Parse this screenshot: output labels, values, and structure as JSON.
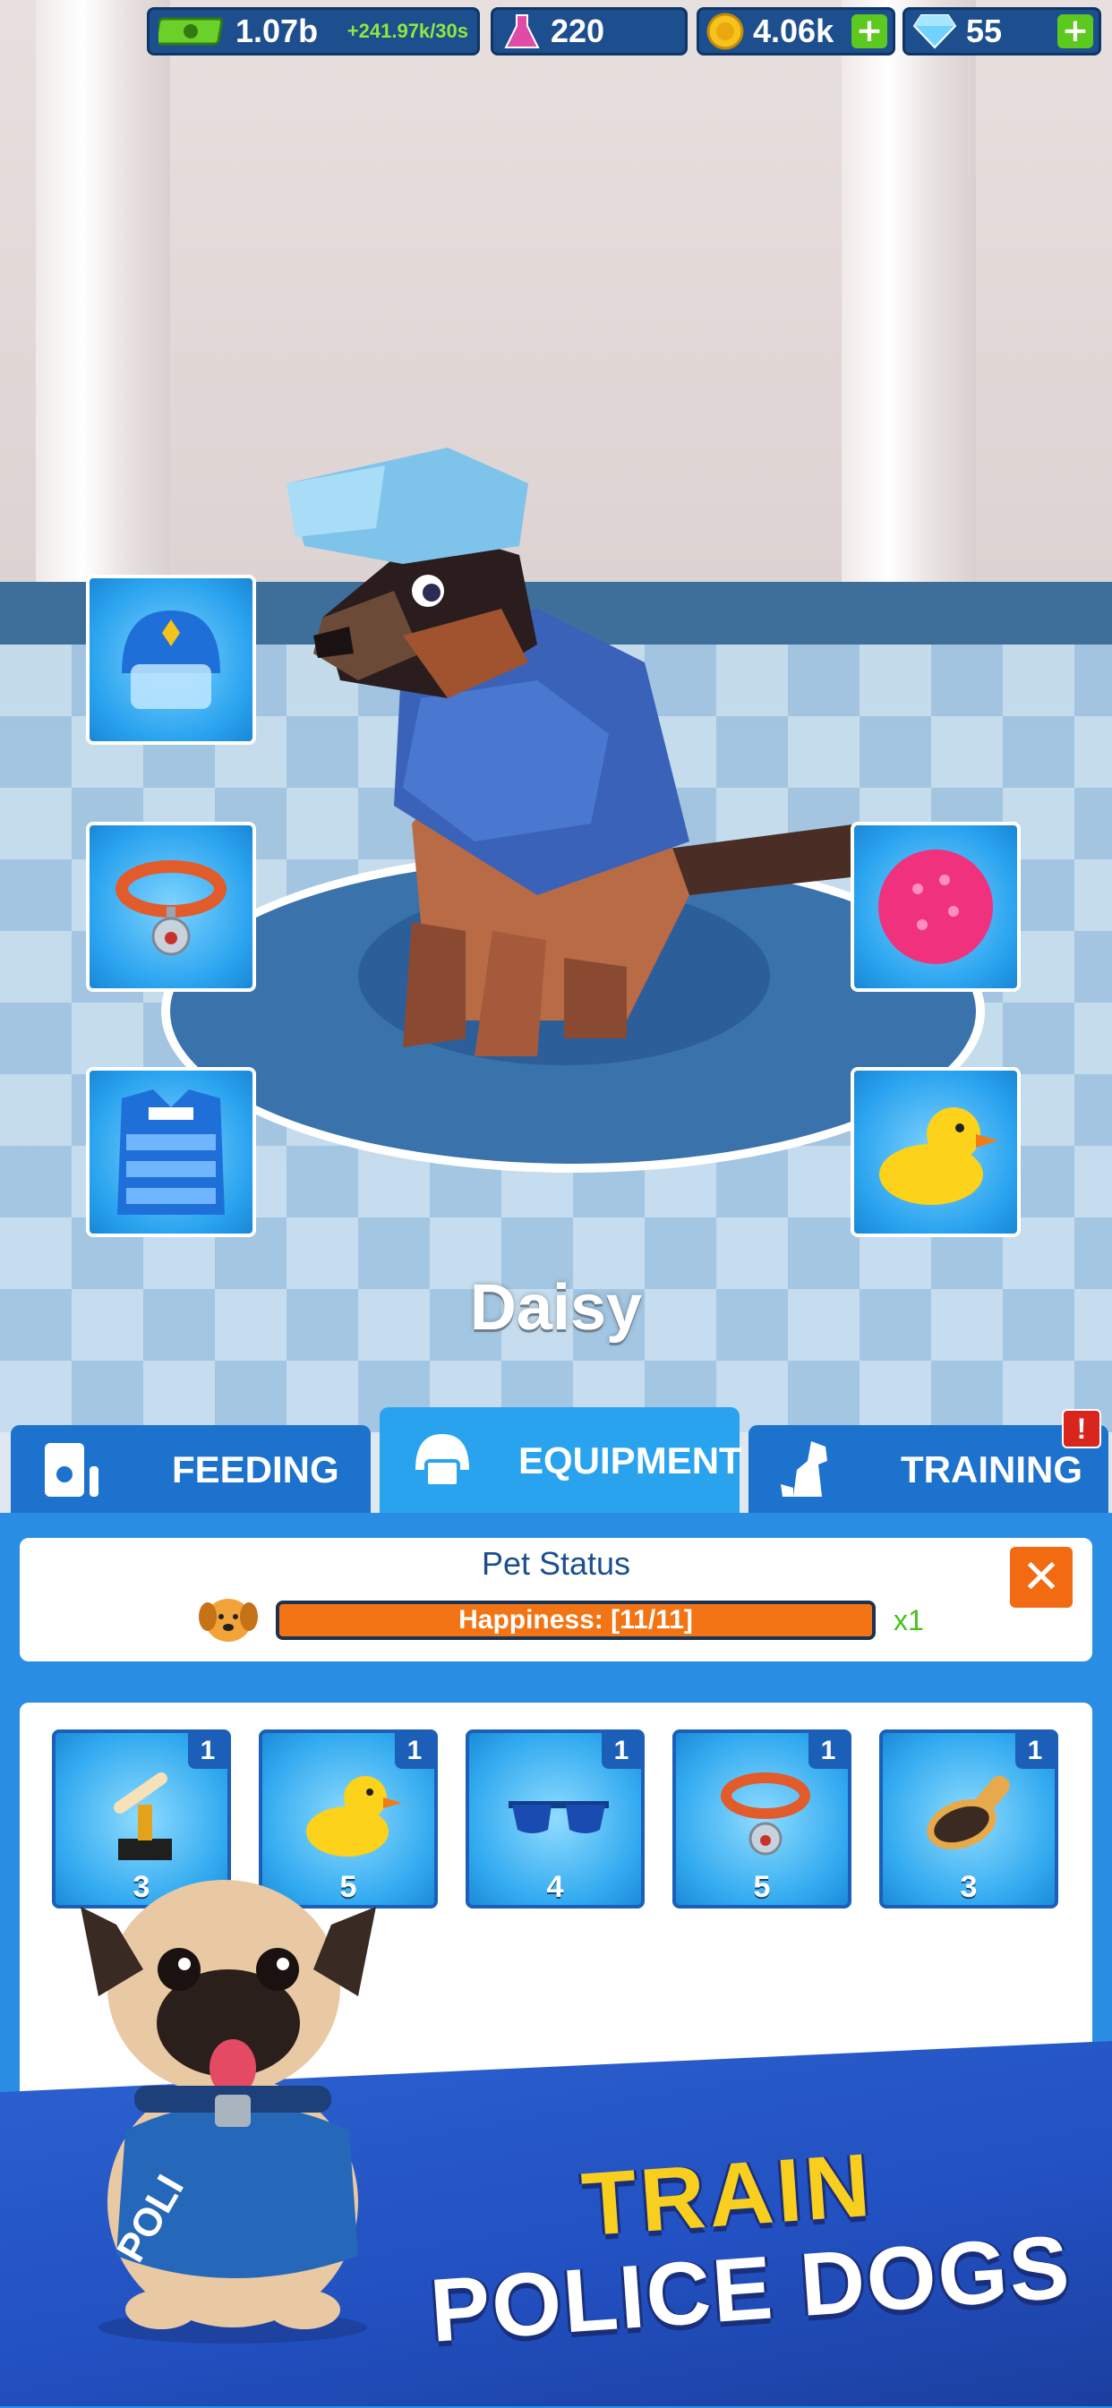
{
  "topbar": {
    "cash": "1.07b",
    "cash_rate": "+241.97k/30s",
    "research": "220",
    "coins": "4.06k",
    "gems": "55",
    "plus": "+"
  },
  "pet": {
    "name": "Daisy"
  },
  "equipment_slots": [
    "helmet-icon",
    "collar-icon",
    "vest-icon",
    "ball-icon",
    "rubber-duck-icon"
  ],
  "tabs": [
    {
      "label": "FEEDING",
      "icon": "food-bag-icon",
      "active": false
    },
    {
      "label": "EQUIPMENT",
      "icon": "helmet-icon",
      "active": true
    },
    {
      "label": "TRAINING",
      "icon": "dog-icon",
      "active": false,
      "alert": "!"
    }
  ],
  "status": {
    "title": "Pet Status",
    "happiness_label": "Happiness: [11/11]",
    "happiness_fraction": 1.0,
    "multiplier": "x1",
    "close": "✕"
  },
  "inventory": [
    {
      "icon": "bone-trophy-icon",
      "count": "1",
      "cost": "3"
    },
    {
      "icon": "rubber-duck-icon",
      "count": "1",
      "cost": "5"
    },
    {
      "icon": "sunglasses-icon",
      "count": "1",
      "cost": "4"
    },
    {
      "icon": "collar-icon",
      "count": "1",
      "cost": "5"
    },
    {
      "icon": "brush-icon",
      "count": "1",
      "cost": "3"
    }
  ],
  "banner": {
    "line1": "TRAIN",
    "line2": "POLICE DOGS"
  },
  "colors": {
    "accent": "#2aa3ef",
    "tab": "#1c72cd",
    "happiness": "#f27414",
    "alert": "#d9261c",
    "title_yellow": "#f9cf1f"
  }
}
